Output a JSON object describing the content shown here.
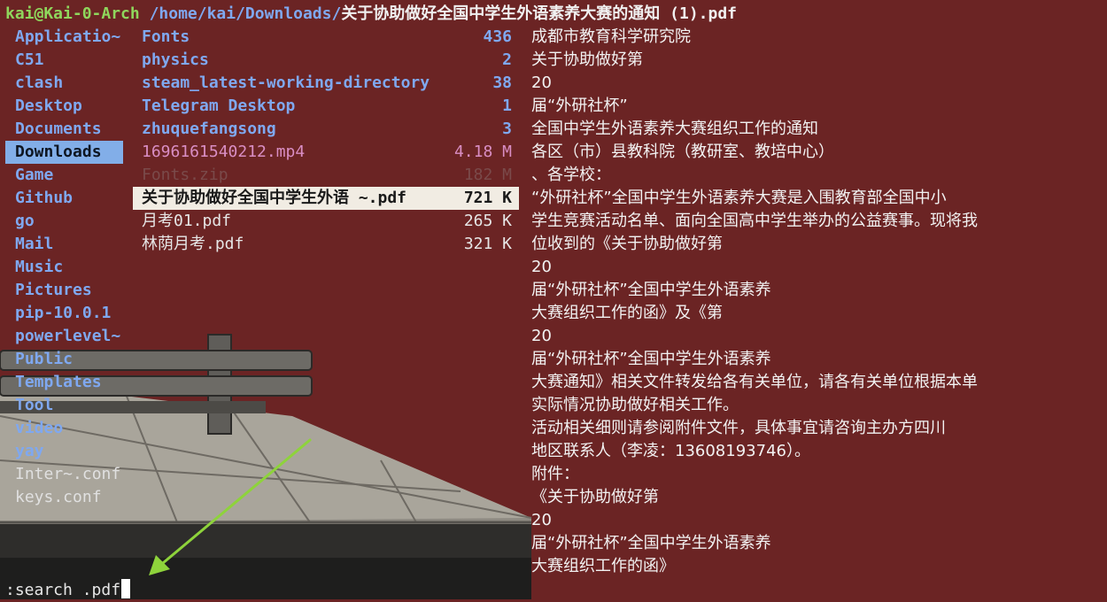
{
  "title": {
    "user_host": "kai@Kai-0-Arch",
    "path": "/home/kai/Downloads/",
    "file": "关于协助做好全国中学生外语素养大赛的通知 (1).pdf"
  },
  "parent_dirs": [
    {
      "label": "Applicatio~",
      "type": "dir"
    },
    {
      "label": "C51",
      "type": "dir"
    },
    {
      "label": "clash",
      "type": "dir"
    },
    {
      "label": "Desktop",
      "type": "dir"
    },
    {
      "label": "Documents",
      "type": "dir"
    },
    {
      "label": "Downloads",
      "type": "dir",
      "selected": true
    },
    {
      "label": "Game",
      "type": "dir"
    },
    {
      "label": "Github",
      "type": "dir"
    },
    {
      "label": "go",
      "type": "dir"
    },
    {
      "label": "Mail",
      "type": "dir"
    },
    {
      "label": "Music",
      "type": "dir"
    },
    {
      "label": "Pictures",
      "type": "dir"
    },
    {
      "label": "pip-10.0.1",
      "type": "dir"
    },
    {
      "label": "powerlevel~",
      "type": "dir"
    },
    {
      "label": "Public",
      "type": "dir"
    },
    {
      "label": "Templates",
      "type": "dir"
    },
    {
      "label": "Tool",
      "type": "dir"
    },
    {
      "label": "video",
      "type": "dir"
    },
    {
      "label": "yay",
      "type": "dir"
    },
    {
      "label": "Inter~.conf",
      "type": "file"
    },
    {
      "label": "keys.conf",
      "type": "file"
    }
  ],
  "current_dir": [
    {
      "name": "Fonts",
      "size": "436",
      "type": "dir"
    },
    {
      "name": "physics",
      "size": "2",
      "type": "dir"
    },
    {
      "name": "steam_latest-working-directory",
      "size": "38",
      "type": "dir"
    },
    {
      "name": "Telegram Desktop",
      "size": "1",
      "type": "dir"
    },
    {
      "name": "zhuquefangsong",
      "size": "3",
      "type": "dir"
    },
    {
      "name": "1696161540212.mp4",
      "size": "4.18 M",
      "type": "media"
    },
    {
      "name": "Fonts.zip",
      "size": "182 M",
      "type": "archive"
    },
    {
      "name": "关于协助做好全国中学生外语 ~.pdf",
      "size": "721 K",
      "type": "file",
      "selected": true
    },
    {
      "name": "月考01.pdf",
      "size": "265 K",
      "type": "file"
    },
    {
      "name": "林荫月考.pdf",
      "size": "321 K",
      "type": "file"
    }
  ],
  "preview_lines": [
    "成都市教育科学研究院",
    "关于协助做好第",
    "20",
    "届“外研社杯”",
    "全国中学生外语素养大赛组织工作的通知",
    "各区（市）县教科院（教研室、教培中心）",
    "、各学校：",
    "“外研社杯”全国中学生外语素养大赛是入围教育部全国中小",
    "学生竞赛活动名单、面向全国高中学生举办的公益赛事。现将我",
    "位收到的《关于协助做好第",
    "20",
    "届“外研社杯”全国中学生外语素养",
    "大赛组织工作的函》及《第",
    "20",
    "届“外研社杯”全国中学生外语素养",
    "大赛通知》相关文件转发给各有关单位，请各有关单位根据本单",
    "实际情况协助做好相关工作。",
    "活动相关细则请参阅附件文件，具体事宜请咨询主办方四川",
    "地区联系人（李凌：13608193746）。",
    "附件：",
    "《关于协助做好第",
    "20",
    "届“外研社杯”全国中学生外语素养",
    "大赛组织工作的函》"
  ],
  "command_line": ":search .pdf",
  "colors": {
    "background": "#6b2424",
    "directory": "#7fa8f0",
    "user_host": "#8fd65c",
    "selection_parent": "#82aee8",
    "selection_current": "#f1ece3",
    "media": "#d98ec4",
    "annotation_arrow": "#8ed33b"
  },
  "icons": {
    "annotation": "arrow-annotation-icon"
  }
}
